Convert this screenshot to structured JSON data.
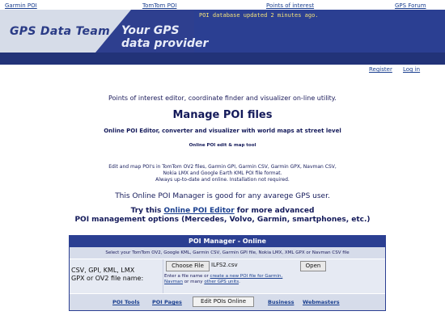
{
  "top_links": [
    "Garmin POI",
    "TomTom POI",
    "Points of interest",
    "GPS Forum"
  ],
  "header": {
    "brand": "GPS Data Team",
    "tagline_line1": "Your GPS",
    "tagline_line2": "data provider",
    "notice": "POI database updated  2 minutes ago."
  },
  "user_links": {
    "register": "Register",
    "login": "Log in"
  },
  "intro": "Points of interest editor, coordinate finder and visualizer on-line utility.",
  "title": "Manage POI files",
  "subtitle": "Online POI Editor, converter and visualizer with world maps at street level",
  "subtitle2": "Online POI edit & map tool",
  "description": {
    "line1": "Edit and map POI's in TomTom OV2 files, Garmin GPI, Garmin CSV, Garmin GPX, Navman CSV,",
    "line2": "Nokia LMX and Google Earth KML POI file format.",
    "line3": "Always up-to-date and online. Installation not required."
  },
  "good_for": "This Online POI Manager is good for any avarege GPS user.",
  "try": {
    "prefix": "Try this ",
    "link": "Online POI Editor",
    "suffix": " for more advanced",
    "line2": "POI management options (Mercedes, Volvo, Garmin, smartphones, etc.)"
  },
  "panel": {
    "header": "POI Manager - Online",
    "description": "Select your TomTom OV2, Google KML, Garmin CSV, Garmin GPI file, Nokia LMX, XML GPX or Navman CSV file",
    "label_line1": "CSV, GPI, KML, LMX",
    "label_line2": "GPX or OV2 file name:",
    "choose_button": "Choose File",
    "file_name": "ILFS2.csv",
    "open_button": "Open",
    "hint_prefix": "Enter a file name or ",
    "hint_link1": "create a new POI file for Garmin,",
    "hint_link2": "Navman",
    "hint_mid": " or many ",
    "hint_link3": "other GPS units",
    "hint_suffix": ".",
    "footer": {
      "poi_tools": "POI Tools",
      "poi_pages": "POI Pages",
      "edit_button": "Edit POIs Online",
      "business": "Business",
      "webmasters": "Webmasters"
    }
  }
}
